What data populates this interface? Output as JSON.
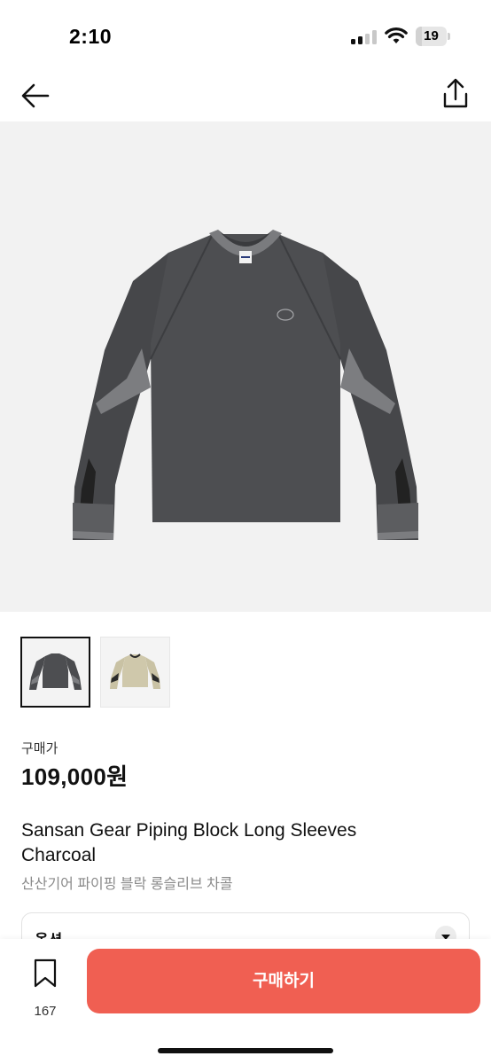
{
  "status_bar": {
    "time": "2:10",
    "battery_level": "19",
    "signal_bars": 2,
    "signal_bars_total": 4,
    "battery_fraction": 0.19
  },
  "nav": {
    "back_icon": "arrow-left-icon",
    "share_icon": "share-upload-icon"
  },
  "product": {
    "price_label": "구매가",
    "price": "109,000원",
    "title_en": "Sansan Gear Piping Block Long Sleeves Charcoal",
    "title_ko": "산산기어 파이핑 블락 롱슬리브 차콜",
    "selected_thumbnail": 1,
    "thumbnails": [
      {
        "color": "charcoal"
      },
      {
        "color": "beige"
      }
    ]
  },
  "option": {
    "label": "옵션",
    "icon": "chevron-down-icon"
  },
  "bottom_bar": {
    "bookmark_icon": "bookmark-icon",
    "bookmark_count": "167",
    "buy_label": "구매하기"
  },
  "colors": {
    "accent": "#f05f52",
    "hero_background": "#f2f2f2",
    "shirt_charcoal": "#4a4b4e",
    "shirt_panel": "#7c7d80",
    "shirt_beige": "#c9c2a4"
  }
}
